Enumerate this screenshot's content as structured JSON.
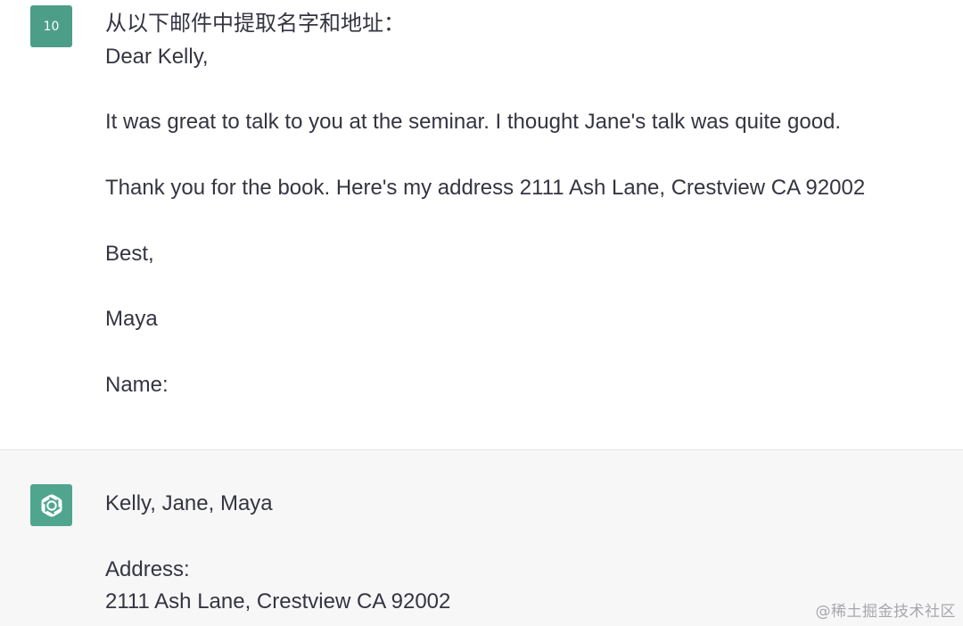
{
  "user_message": {
    "avatar_label": "10",
    "lines": [
      "从以下邮件中提取名字和地址：",
      "Dear Kelly,",
      "",
      "It was great to talk to you at the seminar. I thought Jane's talk was quite good.",
      "",
      "Thank you for the book. Here's my address 2111 Ash Lane, Crestview CA 92002",
      "",
      "Best,",
      "",
      "Maya",
      "",
      "Name:"
    ]
  },
  "assistant_message": {
    "avatar_icon": "openai-logo-icon",
    "lines": [
      "Kelly, Jane, Maya",
      "",
      "Address:",
      "2111 Ash Lane, Crestview CA 92002"
    ]
  },
  "watermark": "@稀土掘金技术社区",
  "colors": {
    "user_avatar_bg": "#4d9e88",
    "assistant_avatar_bg": "#4fa58e",
    "assistant_row_bg": "#f7f7f8",
    "text": "#343541"
  }
}
